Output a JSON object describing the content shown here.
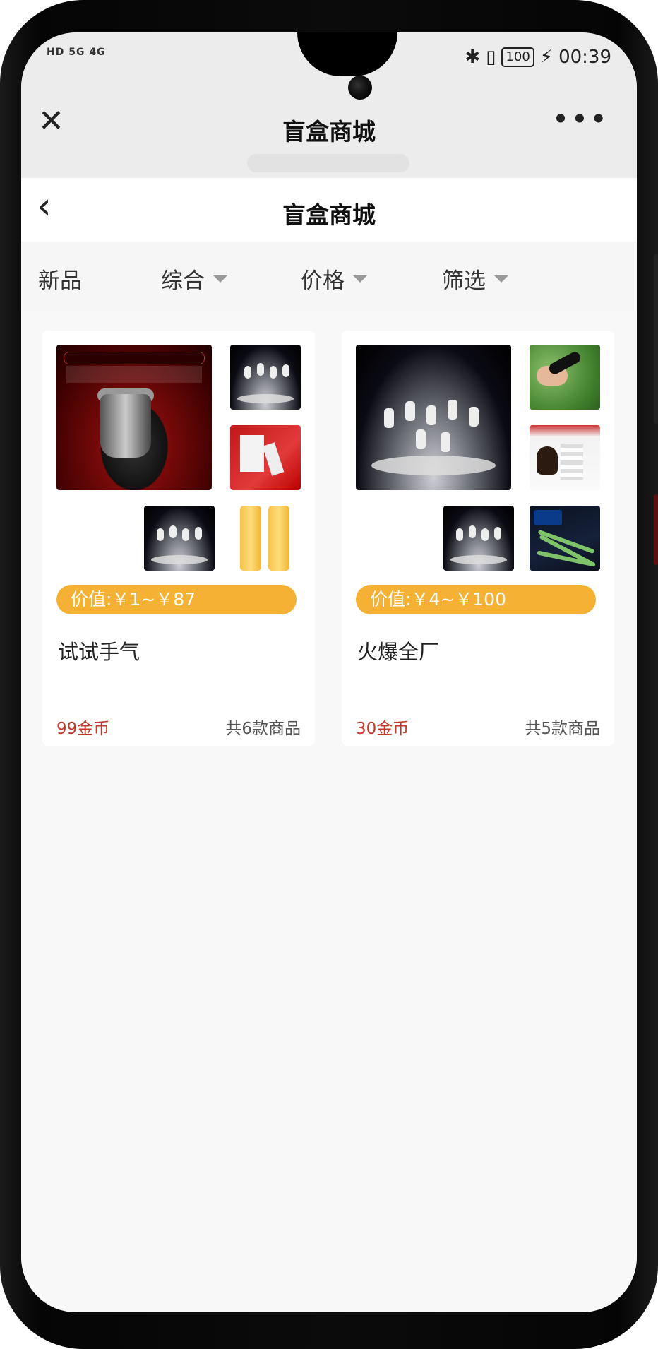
{
  "status_bar": {
    "left_indicators": "HD 5G 4G",
    "battery": "100",
    "time": "00:39"
  },
  "miniprogram_bar": {
    "close_icon": "close-icon",
    "title": "盲盒商城",
    "more_icon": "more-dots-icon"
  },
  "page_header": {
    "back_icon": "chevron-left-icon",
    "title": "盲盒商城"
  },
  "filters": [
    {
      "label": "新品",
      "has_caret": false
    },
    {
      "label": "综合",
      "has_caret": true
    },
    {
      "label": "价格",
      "has_caret": true
    },
    {
      "label": "筛选",
      "has_caret": true
    }
  ],
  "products": [
    {
      "value_range": "价值:￥1~￥87",
      "name": "试试手气",
      "price": "99金币",
      "count": "共6款商品",
      "images": [
        "shaver",
        "astronauts",
        "red-gift-box",
        "astronauts",
        "gold-bars"
      ]
    },
    {
      "value_range": "价值:￥4~￥100",
      "name": "火爆全厂",
      "price": "30金币",
      "count": "共5款商品",
      "images": [
        "astronauts",
        "black-tube-on-grass",
        "bluetooth-earpiece",
        "astronauts",
        "charging-cables"
      ]
    }
  ],
  "colors": {
    "accent_orange": "#f5b133",
    "price_red": "#c0392b",
    "background": "#f8f8f8"
  }
}
